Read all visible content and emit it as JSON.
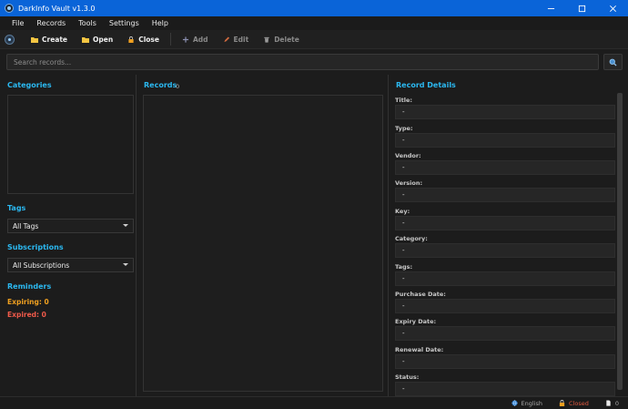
{
  "window": {
    "title": "DarkInfo Vault v1.3.0"
  },
  "menu": {
    "items": [
      "File",
      "Records",
      "Tools",
      "Settings",
      "Help"
    ]
  },
  "toolbar": {
    "create": "Create",
    "open": "Open",
    "close": "Close",
    "add": "Add",
    "edit": "Edit",
    "delete": "Delete"
  },
  "search": {
    "placeholder": "Search records...",
    "value": ""
  },
  "sidebar": {
    "categories_title": "Categories",
    "categories": [],
    "tags_title": "Tags",
    "tags_selected": "All Tags",
    "subscriptions_title": "Subscriptions",
    "subscriptions_selected": "All Subscriptions",
    "reminders_title": "Reminders",
    "expiring": "Expiring: 0",
    "expired": "Expired: 0"
  },
  "records": {
    "title": "Records",
    "count": "0",
    "items": []
  },
  "details": {
    "title": "Record Details",
    "fields": [
      {
        "label": "Title:",
        "value": "-"
      },
      {
        "label": "Type:",
        "value": "-"
      },
      {
        "label": "Vendor:",
        "value": "-"
      },
      {
        "label": "Version:",
        "value": "-"
      },
      {
        "label": "Key:",
        "value": "-"
      },
      {
        "label": "Category:",
        "value": "-"
      },
      {
        "label": "Tags:",
        "value": "-"
      },
      {
        "label": "Purchase Date:",
        "value": "-"
      },
      {
        "label": "Expiry Date:",
        "value": "-"
      },
      {
        "label": "Renewal Date:",
        "value": "-"
      },
      {
        "label": "Status:",
        "value": "-"
      }
    ]
  },
  "status": {
    "language": "English",
    "vault_state": "Closed",
    "record_count": "0"
  },
  "colors": {
    "accent": "#2bb8f0",
    "titlebar": "#0a64d8",
    "expiring": "#f0a020",
    "expired": "#f05a4a",
    "closed": "#e0583f"
  },
  "icons": {
    "app": "vault-logo-icon",
    "create": "folder-icon",
    "open": "folder-open-icon",
    "close": "lock-icon",
    "add": "plus-icon",
    "edit": "pencil-icon",
    "delete": "trash-icon",
    "search": "search-icon",
    "language": "globe-icon",
    "vault_state": "lock-icon",
    "record_count": "document-icon"
  }
}
